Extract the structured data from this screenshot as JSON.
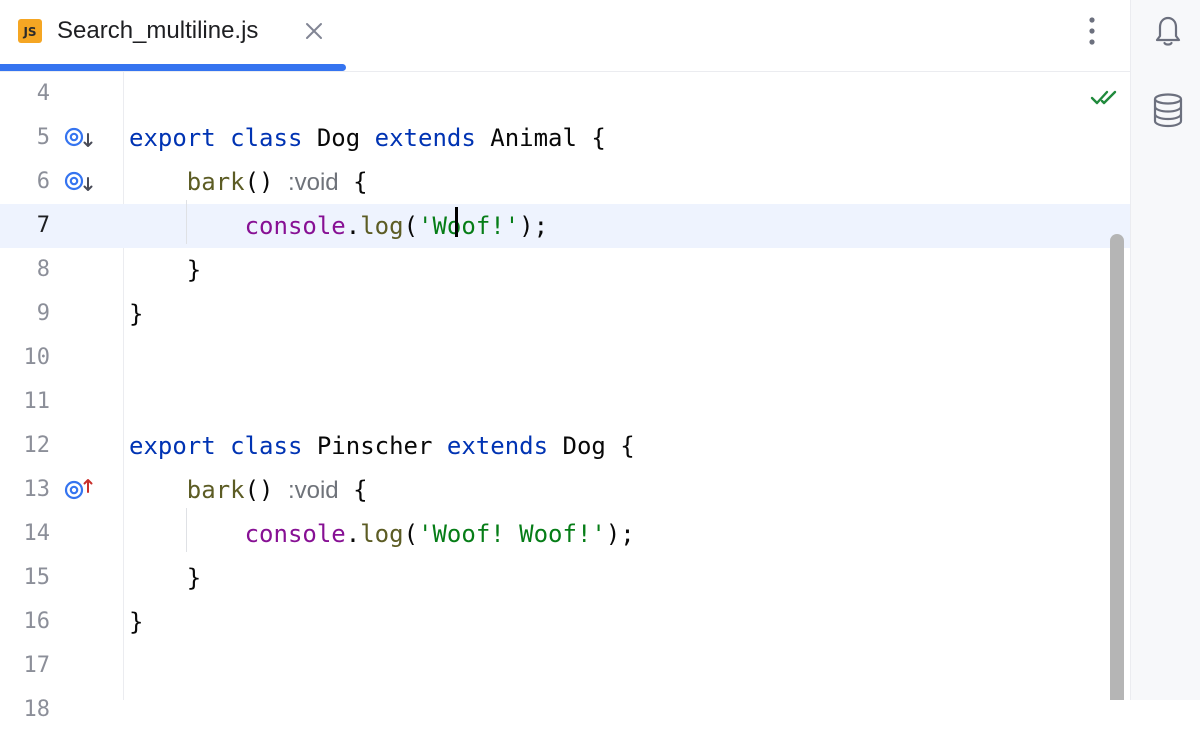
{
  "tab": {
    "icon_text": "JS",
    "title": "Search_multiline.js",
    "close_icon": "close-icon",
    "accent_color": "#3574f0"
  },
  "toolbar": {
    "more_icon": "more-vertical-icon"
  },
  "tool_strip": {
    "notifications_icon": "bell-icon",
    "database_icon": "database-icon"
  },
  "editor": {
    "inspection_status_icon": "double-check-icon",
    "current_line": 7,
    "lines": [
      {
        "number": "4",
        "segments": []
      },
      {
        "number": "5",
        "gutter_icon": "implemented-down-icon",
        "segments": [
          {
            "t": "export",
            "c": "kw"
          },
          {
            "t": " "
          },
          {
            "t": "class",
            "c": "kw"
          },
          {
            "t": " Dog "
          },
          {
            "t": "extends",
            "c": "kw"
          },
          {
            "t": " Animal {"
          }
        ]
      },
      {
        "number": "6",
        "gutter_icon": "implemented-down-icon",
        "segments": [
          {
            "t": "    "
          },
          {
            "t": "bark",
            "c": "fn"
          },
          {
            "t": "() "
          },
          {
            "t": ":void",
            "c": "hint"
          },
          {
            "t": " {"
          }
        ]
      },
      {
        "number": "7",
        "segments": [
          {
            "t": "        "
          },
          {
            "t": "console",
            "c": "purple"
          },
          {
            "t": "."
          },
          {
            "t": "log",
            "c": "fn"
          },
          {
            "t": "("
          },
          {
            "t": "'Woof!'",
            "c": "str"
          },
          {
            "t": ");"
          }
        ]
      },
      {
        "number": "8",
        "segments": [
          {
            "t": "    }"
          }
        ]
      },
      {
        "number": "9",
        "segments": [
          {
            "t": "}"
          }
        ]
      },
      {
        "number": "10",
        "segments": []
      },
      {
        "number": "11",
        "segments": []
      },
      {
        "number": "12",
        "segments": [
          {
            "t": "export",
            "c": "kw"
          },
          {
            "t": " "
          },
          {
            "t": "class",
            "c": "kw"
          },
          {
            "t": " Pinscher "
          },
          {
            "t": "extends",
            "c": "kw"
          },
          {
            "t": " Dog {"
          }
        ]
      },
      {
        "number": "13",
        "gutter_icon": "overrides-up-icon",
        "segments": [
          {
            "t": "    "
          },
          {
            "t": "bark",
            "c": "fn"
          },
          {
            "t": "() "
          },
          {
            "t": ":void",
            "c": "hint"
          },
          {
            "t": " {"
          }
        ]
      },
      {
        "number": "14",
        "segments": [
          {
            "t": "        "
          },
          {
            "t": "console",
            "c": "purple"
          },
          {
            "t": "."
          },
          {
            "t": "log",
            "c": "fn"
          },
          {
            "t": "("
          },
          {
            "t": "'Woof! Woof!'",
            "c": "str"
          },
          {
            "t": ");"
          }
        ]
      },
      {
        "number": "15",
        "segments": [
          {
            "t": "    }"
          }
        ]
      },
      {
        "number": "16",
        "segments": [
          {
            "t": "}"
          }
        ]
      },
      {
        "number": "17",
        "segments": []
      },
      {
        "number": "18",
        "segments": []
      }
    ]
  }
}
